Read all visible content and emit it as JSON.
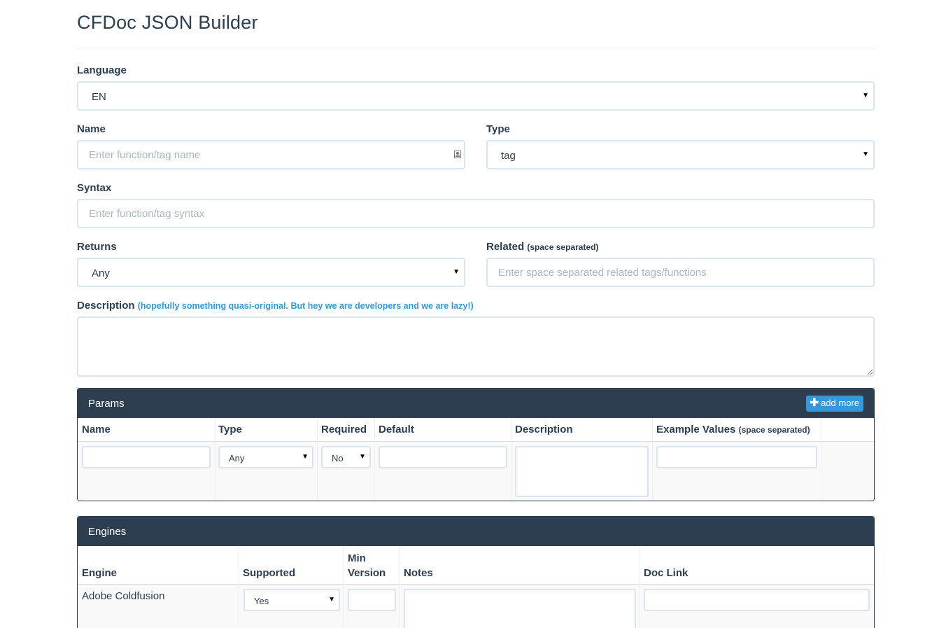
{
  "page": {
    "title": "CFDoc JSON Builder"
  },
  "form": {
    "language": {
      "label": "Language",
      "value": "EN"
    },
    "name": {
      "label": "Name",
      "placeholder": "Enter function/tag name"
    },
    "type": {
      "label": "Type",
      "value": "tag"
    },
    "syntax": {
      "label": "Syntax",
      "placeholder": "Enter function/tag syntax"
    },
    "returns": {
      "label": "Returns",
      "value": "Any"
    },
    "related": {
      "label": "Related",
      "hint": "(space separated)",
      "placeholder": "Enter space separated related tags/functions"
    },
    "description": {
      "label": "Description",
      "hint": "(hopefully something quasi-original. But hey we are developers and we are lazy!)"
    }
  },
  "params": {
    "title": "Params",
    "add_label": "add more",
    "columns": {
      "name": "Name",
      "type": "Type",
      "required": "Required",
      "default": "Default",
      "description": "Description",
      "examples": "Example Values",
      "examples_hint": "(space separated)"
    },
    "row": {
      "type_value": "Any",
      "required_value": "No"
    }
  },
  "engines": {
    "title": "Engines",
    "columns": {
      "engine": "Engine",
      "supported": "Supported",
      "min_version_1": "Min",
      "min_version_2": "Version",
      "notes": "Notes",
      "doc_link": "Doc Link"
    },
    "rows": [
      {
        "engine": "Adobe Coldfusion",
        "supported": "Yes"
      }
    ]
  },
  "colors": {
    "primary": "#2c3e50",
    "accent": "#3498db",
    "border": "#dce4ec",
    "placeholder": "#acb6c0"
  },
  "icons": {
    "select_caret": "triangle-down",
    "contact": "contact-card-icon",
    "add": "plus-icon"
  }
}
